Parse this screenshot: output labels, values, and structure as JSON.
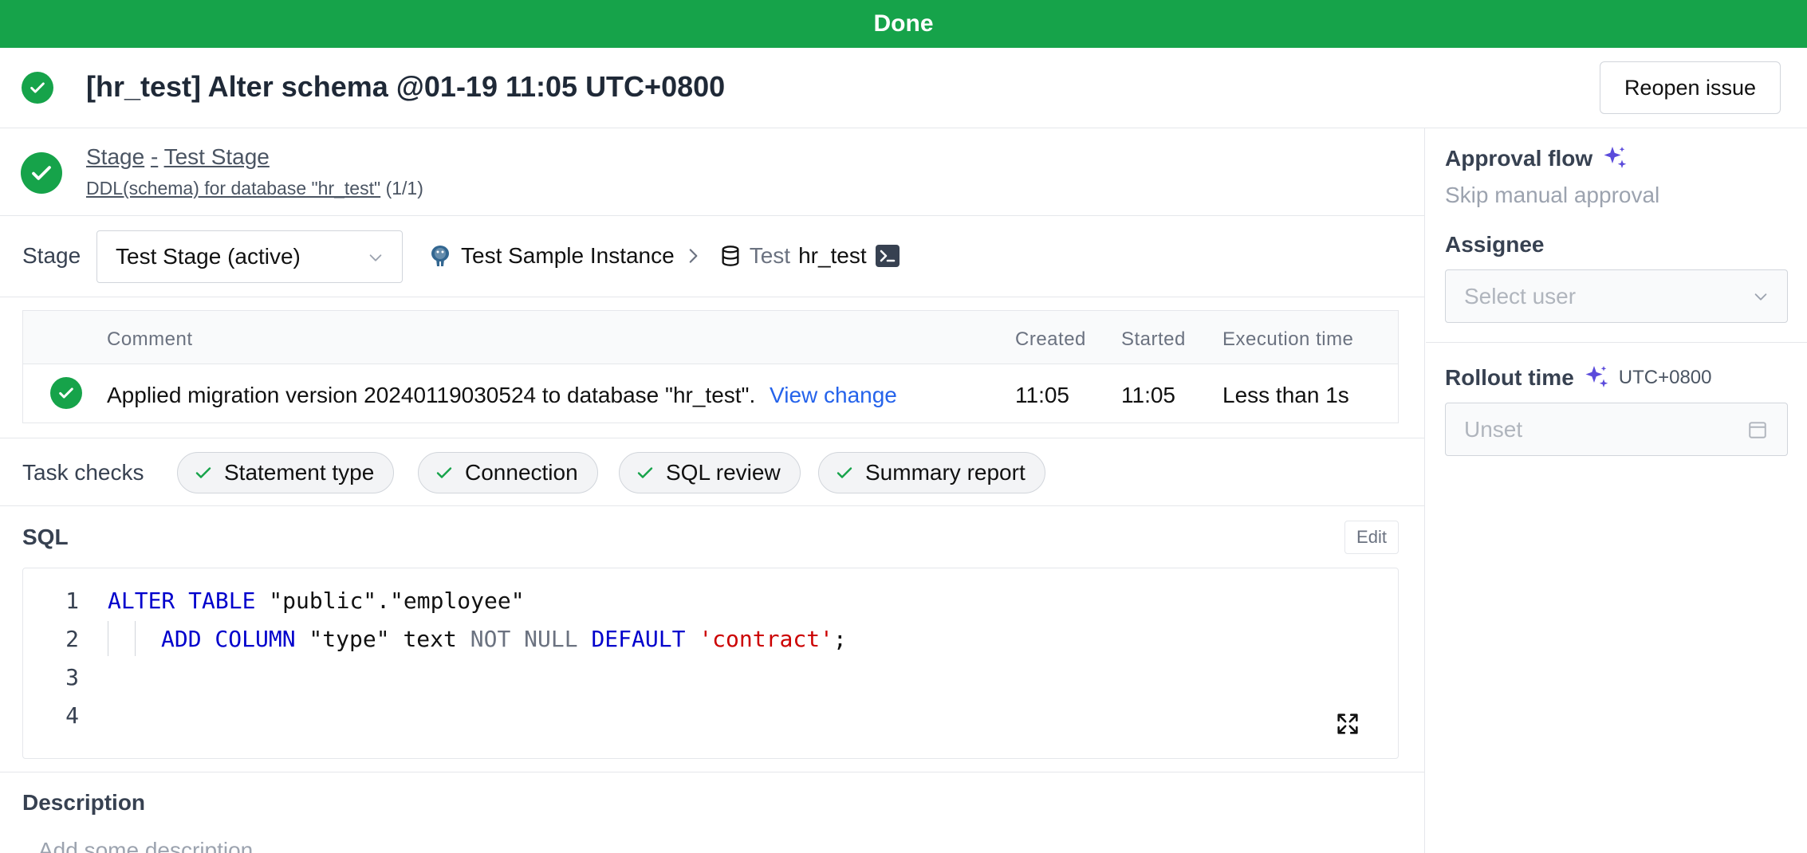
{
  "banner": {
    "text": "Done"
  },
  "header": {
    "title": "[hr_test] Alter schema @01-19 11:05 UTC+0800",
    "reopen_label": "Reopen issue"
  },
  "stage": {
    "prefix": "Stage",
    "separator": "-",
    "name": "Test Stage",
    "task_link": "DDL(schema) for database \"hr_test\"",
    "task_count": "(1/1)"
  },
  "stage_selector": {
    "label": "Stage",
    "selected": "Test Stage (active)",
    "instance": "Test Sample Instance",
    "environment": "Test",
    "database": "hr_test"
  },
  "task_table": {
    "columns": [
      "Comment",
      "Created",
      "Started",
      "Execution time"
    ],
    "rows": [
      {
        "comment": "Applied migration version 20240119030524 to database \"hr_test\".",
        "link": "View change",
        "created": "11:05",
        "started": "11:05",
        "execution_time": "Less than 1s"
      }
    ]
  },
  "task_checks": {
    "label": "Task checks",
    "items": [
      "Statement type",
      "Connection",
      "SQL review",
      "Summary report"
    ]
  },
  "sql": {
    "label": "SQL",
    "edit_label": "Edit",
    "line_numbers": [
      "1",
      "2",
      "3",
      "4"
    ],
    "tokens": {
      "l1_kw": "ALTER TABLE",
      "l1_rest": " \"public\".\"employee\"",
      "l2_kw": "ADD COLUMN",
      "l2_mid": " \"type\" text ",
      "l2_not": "NOT NULL",
      "l2_space": " ",
      "l2_default": "DEFAULT",
      "l2_space2": " ",
      "l2_str": "'contract'",
      "l2_end": ";"
    }
  },
  "description": {
    "label": "Description",
    "placeholder": "Add some description..."
  },
  "sidebar": {
    "approval_title": "Approval flow",
    "approval_value": "Skip manual approval",
    "assignee_title": "Assignee",
    "assignee_placeholder": "Select user",
    "rollout_title": "Rollout time",
    "rollout_tz": "UTC+0800",
    "rollout_placeholder": "Unset"
  },
  "colors": {
    "success": "#16a34a",
    "link": "#2563eb",
    "sparkle": "#5b4bdb"
  }
}
